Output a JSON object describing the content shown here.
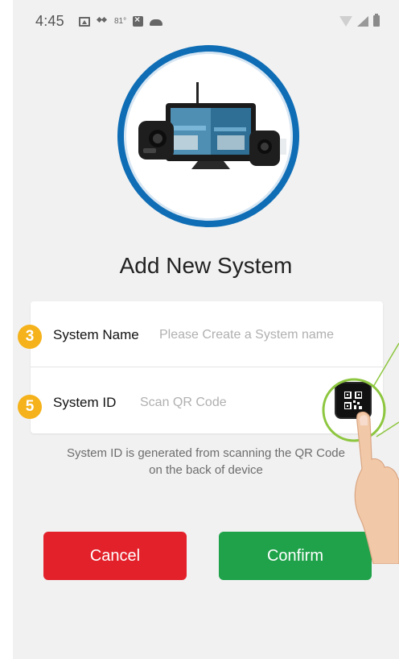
{
  "status_bar": {
    "time": "4:45",
    "temperature": "81°",
    "icons_left": [
      "image-icon",
      "dropbox-icon",
      "temperature",
      "notification-box-icon",
      "cloud-icon"
    ],
    "icons_right": [
      "wifi-icon",
      "signal-icon",
      "battery-icon"
    ]
  },
  "title": "Add New System",
  "form": {
    "name_label": "System Name",
    "name_placeholder": "Please Create a System name",
    "id_label": "System ID",
    "id_placeholder": "Scan QR Code"
  },
  "badges": {
    "name_step": "3",
    "id_step": "5"
  },
  "hint": {
    "line1": "System ID is generated from scanning the QR Code",
    "line2": "on the back of device"
  },
  "buttons": {
    "cancel": "Cancel",
    "confirm": "Confirm"
  },
  "colors": {
    "accent_blue": "#0e6db5",
    "cancel_red": "#e3212b",
    "confirm_green": "#1fa24a",
    "badge_yellow": "#f5b21a",
    "highlight_green": "#8dc63f"
  }
}
